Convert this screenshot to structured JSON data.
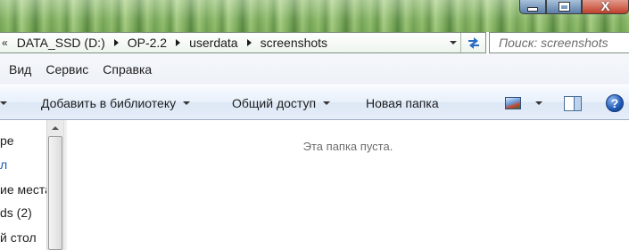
{
  "window": {
    "min_icon": "minimize-icon",
    "max_icon": "maximize-icon",
    "close_icon": "close-icon",
    "close_glyph": "X"
  },
  "address": {
    "overflow_glyph": "«",
    "crumbs": [
      "DATA_SSD (D:)",
      "OP-2.2",
      "userdata",
      "screenshots"
    ],
    "refresh_icon": "refresh-icon"
  },
  "search": {
    "placeholder": "Поиск: screenshots"
  },
  "menu": {
    "items": [
      "Вид",
      "Сервис",
      "Справка"
    ]
  },
  "commands": {
    "add_to_library": "Добавить в библиотеку",
    "share": "Общий доступ",
    "new_folder": "Новая папка",
    "views_icon": "change-view-icon",
    "preview_pane_icon": "preview-pane-icon",
    "help_glyph": "?"
  },
  "nav": {
    "items": [
      "ре",
      "л",
      "ие места",
      "ds (2)",
      "й стол"
    ]
  },
  "content": {
    "empty_message": "Эта папка пуста."
  },
  "colors": {
    "accent": "#1f57b6",
    "empty_text": "#6d6d6d"
  }
}
